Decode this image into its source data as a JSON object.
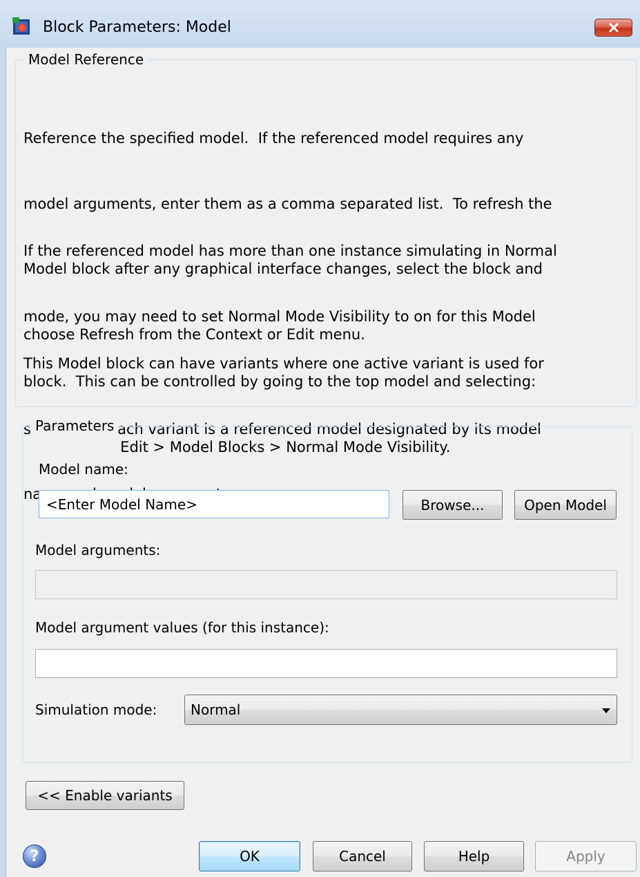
{
  "window": {
    "title": "Block Parameters: Model",
    "icons": {
      "app": "simulink-block-icon",
      "close": "close-icon",
      "help": "help-icon"
    },
    "colors": {
      "titlebar": "#c9dcef",
      "close_button": "#c4331c",
      "default_button": "#bee6fd"
    }
  },
  "model_reference": {
    "legend": "Model Reference",
    "paragraph1_lines": [
      "Reference the specified model.  If the referenced model requires any",
      "model arguments, enter them as a comma separated list.  To refresh the",
      "Model block after any graphical interface changes, select the block and",
      "choose Refresh from the Context or Edit menu."
    ],
    "paragraph2_lines": [
      "If the referenced model has more than one instance simulating in Normal",
      "mode, you may need to set Normal Mode Visibility to on for this Model",
      "block.  This can be controlled by going to the top model and selecting:",
      "                     Edit > Model Blocks > Normal Mode Visibility."
    ],
    "paragraph3_lines": [
      "This Model block can have variants where one active variant is used for",
      "simulation. Each variant is a referenced model designated by its model",
      "name and model arguments."
    ]
  },
  "parameters": {
    "legend": "Parameters",
    "model_name": {
      "label": "Model name:",
      "value": "<Enter Model Name>",
      "browse_label": "Browse...",
      "open_model_label": "Open Model"
    },
    "model_arguments": {
      "label": "Model arguments:",
      "value": ""
    },
    "model_argument_values": {
      "label": "Model argument values (for this instance):",
      "value": ""
    },
    "simulation_mode": {
      "label": "Simulation mode:",
      "selected": "Normal"
    }
  },
  "footer": {
    "enable_variants_label": "<< Enable variants",
    "ok_label": "OK",
    "cancel_label": "Cancel",
    "help_label": "Help",
    "apply_label": "Apply",
    "help_icon_glyph": "?"
  }
}
